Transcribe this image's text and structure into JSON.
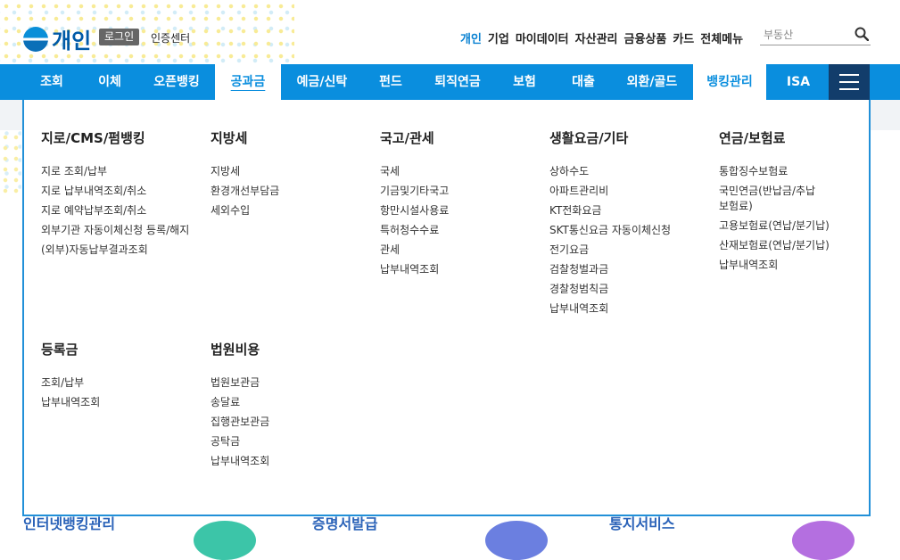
{
  "header": {
    "logo_text": "개인",
    "login_button": "로그인",
    "cert_center": "인증센터",
    "util_nav": [
      "개인",
      "기업",
      "마이데이터",
      "자산관리",
      "금융상품",
      "카드",
      "전체메뉴"
    ],
    "search": {
      "placeholder": "부동산"
    }
  },
  "gnb": {
    "items": [
      "조회",
      "이체",
      "오픈뱅킹",
      "공과금",
      "예금/신탁",
      "펀드",
      "퇴직연금",
      "보험",
      "대출",
      "외환/골드",
      "뱅킹관리",
      "ISA"
    ]
  },
  "menu": {
    "sections": [
      {
        "title": "지로/CMS/펌뱅킹",
        "items": [
          "지로 조회/납부",
          "지로 납부내역조회/취소",
          "지로 예약납부조회/취소",
          "외부기관 자동이체신청 등록/해지",
          "(외부)자동납부결과조회"
        ]
      },
      {
        "title": "지방세",
        "items": [
          "지방세",
          "환경개선부담금",
          "세외수입"
        ]
      },
      {
        "title": "국고/관세",
        "items": [
          "국세",
          "기금및기타국고",
          "항만시설사용료",
          "특허청수수료",
          "관세",
          "납부내역조회"
        ]
      },
      {
        "title": "생활요금/기타",
        "items": [
          "상하수도",
          "아파트관리비",
          "KT전화요금",
          "SKT통신요금 자동이체신청",
          "전기요금",
          "검찰청벌과금",
          "경찰청범칙금",
          "납부내역조회"
        ]
      },
      {
        "title": "연금/보험료",
        "items": [
          "통합징수보험료",
          "국민연금(반납금/추납보험료)",
          "고용보험료(연납/분기납)",
          "산재보험료(연납/분기납)",
          "납부내역조회"
        ]
      },
      {
        "title": "등록금",
        "items": [
          "조회/납부",
          "납부내역조회"
        ]
      },
      {
        "title": "법원비용",
        "items": [
          "법원보관금",
          "송달료",
          "집행관보관금",
          "공탁금",
          "납부내역조회"
        ]
      }
    ]
  },
  "below": {
    "links": [
      "인터넷뱅킹관리",
      "증명서발급",
      "통지서비스"
    ]
  },
  "colors": {
    "primary": "#0a8ede",
    "menu_button": "#123d6b",
    "panel_border": "#2190d8"
  }
}
